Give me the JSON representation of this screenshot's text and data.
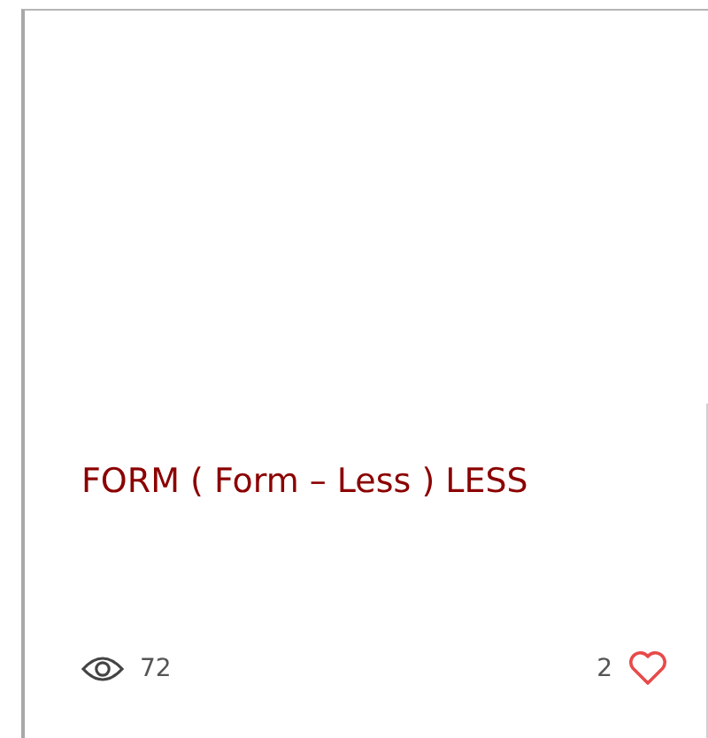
{
  "post": {
    "title": "FORM ( Form – Less ) LESS",
    "views": "72",
    "likes": "2",
    "liked": false
  }
}
